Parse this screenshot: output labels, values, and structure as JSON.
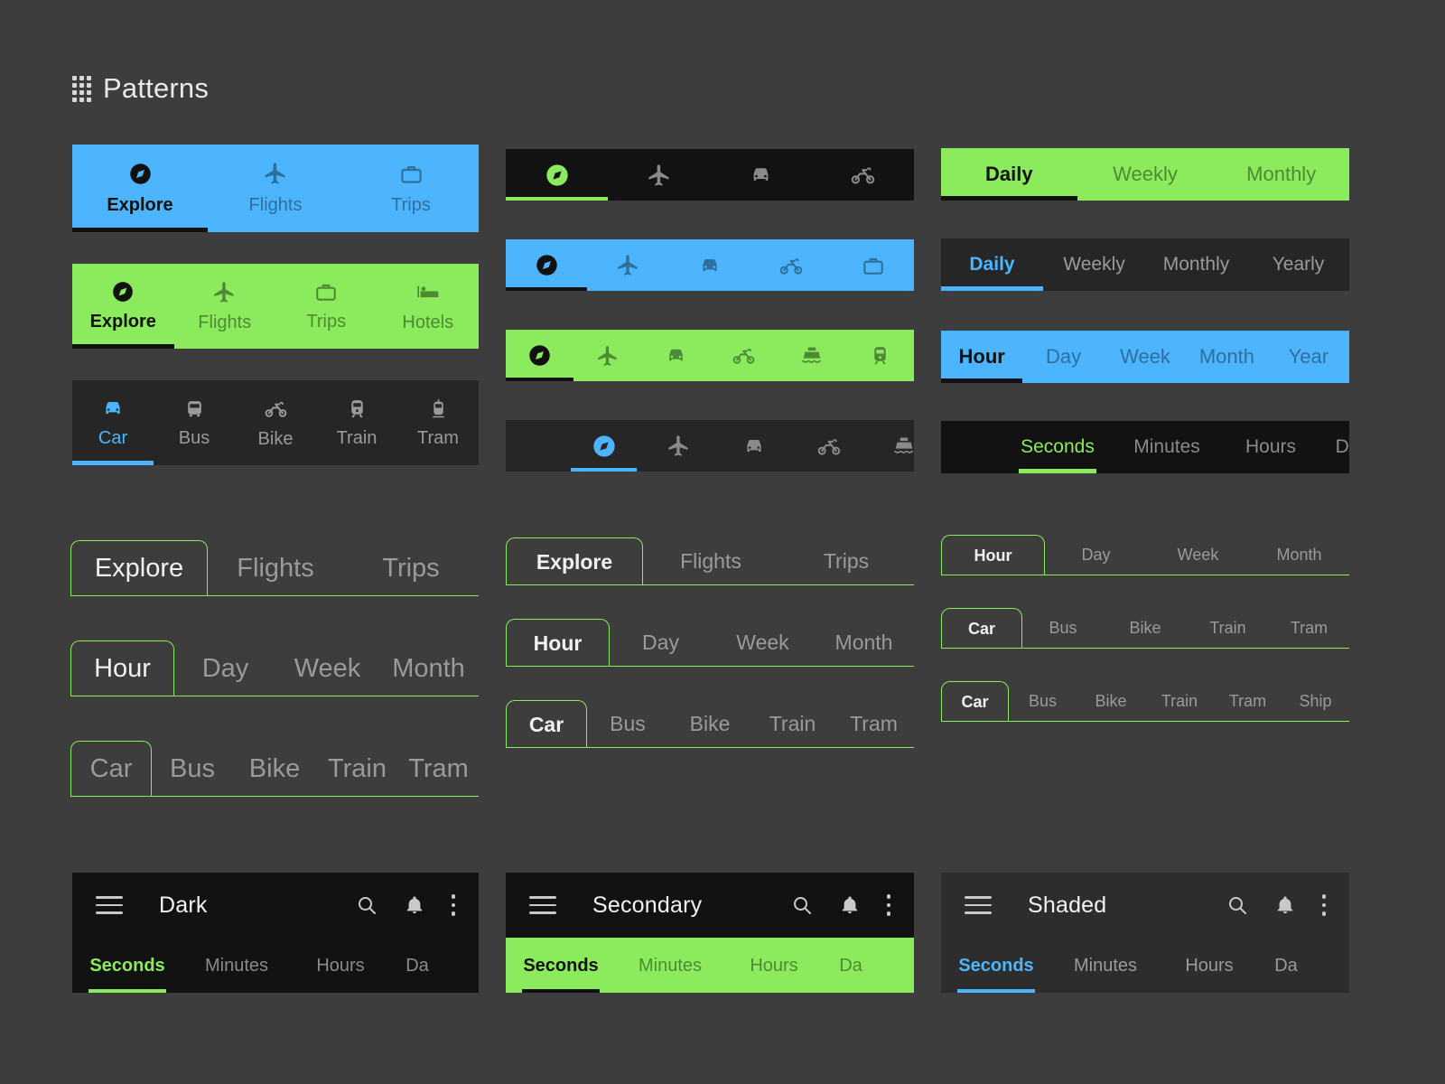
{
  "header": {
    "title": "Patterns",
    "icon": "grid-apps-icon"
  },
  "colors": {
    "background": "#3d3d3d",
    "blue": "#4db5fd",
    "green": "#8beb5c",
    "black": "#121212",
    "shaded": "#262626",
    "active_dark": "#111111",
    "inactive_on_blue": "#2f6f9b",
    "inactive_on_green": "#4e8a35",
    "inactive_on_dark": "#9a9a9a"
  },
  "left_column": {
    "filled_blue_icon_text": {
      "name": "blue-icon-text-tabs",
      "active_index": 0,
      "tabs": [
        {
          "label": "Explore",
          "icon": "compass-icon"
        },
        {
          "label": "Flights",
          "icon": "airplane-icon"
        },
        {
          "label": "Trips",
          "icon": "briefcase-icon"
        }
      ]
    },
    "filled_green_icon_text": {
      "name": "green-icon-text-tabs",
      "active_index": 0,
      "tabs": [
        {
          "label": "Explore",
          "icon": "compass-icon"
        },
        {
          "label": "Flights",
          "icon": "airplane-icon"
        },
        {
          "label": "Trips",
          "icon": "briefcase-icon"
        },
        {
          "label": "Hotels",
          "icon": "hotel-bed-icon"
        }
      ]
    },
    "shaded_icon_text": {
      "name": "shaded-icon-text-tabs",
      "active_index": 0,
      "tabs": [
        {
          "label": "Car",
          "icon": "car-icon"
        },
        {
          "label": "Bus",
          "icon": "bus-icon"
        },
        {
          "label": "Bike",
          "icon": "motorbike-icon"
        },
        {
          "label": "Train",
          "icon": "train-icon"
        },
        {
          "label": "Tram",
          "icon": "tram-icon"
        }
      ]
    },
    "outlined_large": {
      "name": "outlined-tabs-explore-large",
      "active_index": 0,
      "tabs": [
        "Explore",
        "Flights",
        "Trips"
      ]
    },
    "outlined_medium": {
      "name": "outlined-tabs-hour-large",
      "active_index": 0,
      "tabs": [
        "Hour",
        "Day",
        "Week",
        "Month"
      ]
    },
    "outlined_small": {
      "name": "outlined-tabs-car-large",
      "active_index": 0,
      "tabs": [
        "Car",
        "Bus",
        "Bike",
        "Train",
        "Tram"
      ]
    },
    "appbar": {
      "name": "dark-app-bar",
      "title": "Dark",
      "menu_icon": "hamburger-icon",
      "search_icon": "search-icon",
      "bell_icon": "notification-bell-icon",
      "more_icon": "more-vertical-icon",
      "active_index": 0,
      "tabs": [
        "Seconds",
        "Minutes",
        "Hours",
        "Da"
      ]
    }
  },
  "middle_column": {
    "black_icon_bar": {
      "name": "black-icon-only-tabs",
      "active_index": 0,
      "tabs": [
        {
          "icon": "compass-icon"
        },
        {
          "icon": "airplane-icon"
        },
        {
          "icon": "car-icon"
        },
        {
          "icon": "motorbike-icon"
        }
      ]
    },
    "blue_icon_bar": {
      "name": "blue-icon-only-tabs",
      "active_index": 0,
      "tabs": [
        {
          "icon": "compass-icon"
        },
        {
          "icon": "airplane-icon"
        },
        {
          "icon": "car-icon"
        },
        {
          "icon": "motorbike-icon"
        },
        {
          "icon": "briefcase-icon"
        }
      ]
    },
    "green_icon_bar": {
      "name": "green-icon-only-tabs",
      "active_index": 0,
      "tabs": [
        {
          "icon": "compass-icon"
        },
        {
          "icon": "airplane-icon"
        },
        {
          "icon": "car-icon"
        },
        {
          "icon": "motorbike-icon"
        },
        {
          "icon": "ferry-icon"
        },
        {
          "icon": "train-icon"
        }
      ]
    },
    "shaded_icon_bar": {
      "name": "shaded-scrollable-icon-tabs",
      "active_index": 0,
      "scrolled": true,
      "tabs": [
        {
          "icon": "compass-icon"
        },
        {
          "icon": "airplane-icon"
        },
        {
          "icon": "car-icon"
        },
        {
          "icon": "motorbike-icon"
        },
        {
          "icon": "ferry-icon"
        }
      ]
    },
    "outlined_explore": {
      "name": "outlined-tabs-explore-medium",
      "active_index": 0,
      "tabs": [
        "Explore",
        "Flights",
        "Trips"
      ]
    },
    "outlined_hour": {
      "name": "outlined-tabs-hour-medium",
      "active_index": 0,
      "tabs": [
        "Hour",
        "Day",
        "Week",
        "Month"
      ]
    },
    "outlined_car": {
      "name": "outlined-tabs-car-medium",
      "active_index": 0,
      "tabs": [
        "Car",
        "Bus",
        "Bike",
        "Train",
        "Tram"
      ]
    },
    "appbar": {
      "name": "secondary-app-bar",
      "title": "Secondary",
      "menu_icon": "hamburger-icon",
      "search_icon": "search-icon",
      "bell_icon": "notification-bell-icon",
      "more_icon": "more-vertical-icon",
      "active_index": 0,
      "tabs": [
        "Seconds",
        "Minutes",
        "Hours",
        "Da"
      ]
    }
  },
  "right_column": {
    "green_text_tabs": {
      "name": "green-text-tabs-daily",
      "active_index": 0,
      "tabs": [
        "Daily",
        "Weekly",
        "Monthly"
      ]
    },
    "shaded_text_tabs": {
      "name": "shaded-text-tabs-daily",
      "active_index": 0,
      "tabs": [
        "Daily",
        "Weekly",
        "Monthly",
        "Yearly"
      ]
    },
    "blue_text_tabs": {
      "name": "blue-text-tabs-hour",
      "active_index": 0,
      "tabs": [
        "Hour",
        "Day",
        "Week",
        "Month",
        "Year"
      ]
    },
    "black_text_tabs": {
      "name": "black-scrollable-text-tabs-seconds",
      "active_index": 0,
      "scrolled": true,
      "tabs": [
        "Seconds",
        "Minutes",
        "Hours",
        "Da"
      ]
    },
    "outlined_hour": {
      "name": "outlined-tabs-hour-small",
      "active_index": 0,
      "tabs": [
        "Hour",
        "Day",
        "Week",
        "Month"
      ]
    },
    "outlined_car5": {
      "name": "outlined-tabs-car-small",
      "active_index": 0,
      "tabs": [
        "Car",
        "Bus",
        "Bike",
        "Train",
        "Tram"
      ]
    },
    "outlined_car6": {
      "name": "outlined-tabs-car-xsmall",
      "active_index": 0,
      "tabs": [
        "Car",
        "Bus",
        "Bike",
        "Train",
        "Tram",
        "Ship"
      ]
    },
    "appbar": {
      "name": "shaded-app-bar",
      "title": "Shaded",
      "menu_icon": "hamburger-icon",
      "search_icon": "search-icon",
      "bell_icon": "notification-bell-icon",
      "more_icon": "more-vertical-icon",
      "active_index": 0,
      "tabs": [
        "Seconds",
        "Minutes",
        "Hours",
        "Da"
      ]
    }
  }
}
